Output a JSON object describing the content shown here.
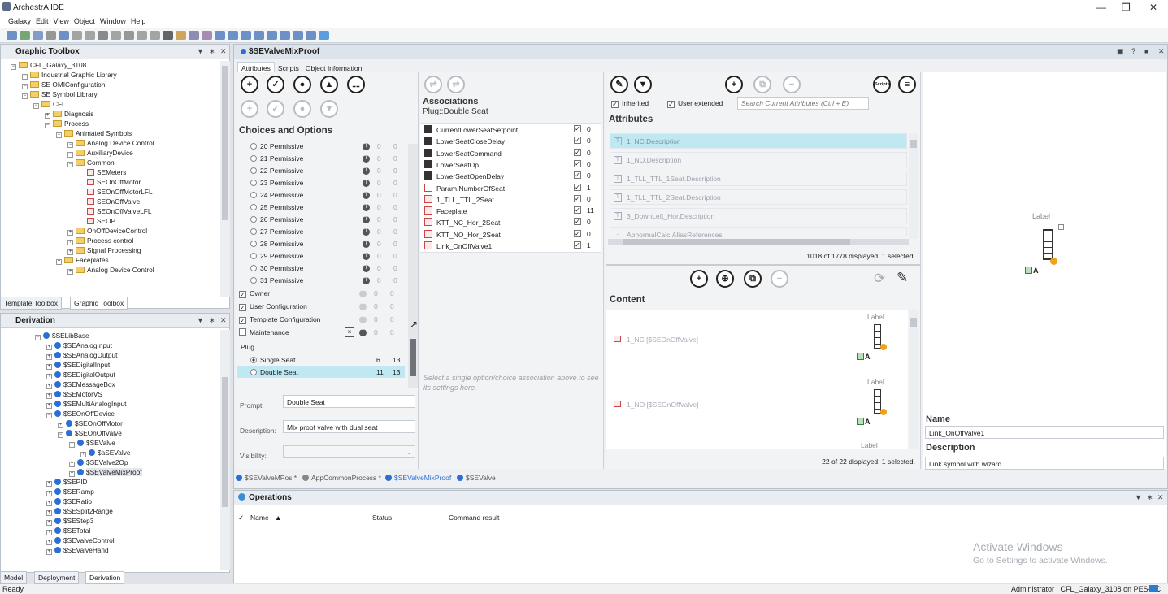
{
  "app": {
    "title": "ArchestrA IDE"
  },
  "menu": [
    "Galaxy",
    "Edit",
    "View",
    "Object",
    "Window",
    "Help"
  ],
  "toolbox": {
    "title": "Graphic Toolbox",
    "tree": [
      {
        "d": 0,
        "t": "CFL_Galaxy_3108",
        "k": "root"
      },
      {
        "d": 1,
        "t": "Industrial Graphic Library",
        "k": "folder"
      },
      {
        "d": 1,
        "t": "SE OMIConfiguration",
        "k": "folder"
      },
      {
        "d": 1,
        "t": "SE Symbol Library",
        "k": "folder"
      },
      {
        "d": 2,
        "t": "CFL",
        "k": "folder"
      },
      {
        "d": 3,
        "t": "Diagnosis",
        "k": "folder"
      },
      {
        "d": 3,
        "t": "Process",
        "k": "folder"
      },
      {
        "d": 4,
        "t": "Animated Symbols",
        "k": "folder"
      },
      {
        "d": 5,
        "t": "Analog Device Control",
        "k": "folder"
      },
      {
        "d": 5,
        "t": "AuxiliaryDevice",
        "k": "folder"
      },
      {
        "d": 5,
        "t": "Common",
        "k": "folder"
      },
      {
        "d": 6,
        "t": "SEMeters",
        "k": "sym"
      },
      {
        "d": 6,
        "t": "SEOnOffMotor",
        "k": "sym"
      },
      {
        "d": 6,
        "t": "SEOnOffMotorLFL",
        "k": "sym"
      },
      {
        "d": 6,
        "t": "SEOnOffValve",
        "k": "sym"
      },
      {
        "d": 6,
        "t": "SEOnOffValveLFL",
        "k": "sym"
      },
      {
        "d": 6,
        "t": "SEOP",
        "k": "sym"
      },
      {
        "d": 5,
        "t": "OnOffDeviceControl",
        "k": "folder"
      },
      {
        "d": 5,
        "t": "Process control",
        "k": "folder"
      },
      {
        "d": 5,
        "t": "Signal Processing",
        "k": "folder"
      },
      {
        "d": 4,
        "t": "Faceplates",
        "k": "folder"
      },
      {
        "d": 5,
        "t": "Analog Device Control",
        "k": "folder"
      }
    ],
    "tabs": [
      "Template Toolbox",
      "Graphic Toolbox"
    ]
  },
  "derivation": {
    "title": "Derivation",
    "tree": [
      {
        "d": 0,
        "t": "$SELibBase"
      },
      {
        "d": 1,
        "t": "$SEAnalogInput"
      },
      {
        "d": 1,
        "t": "$SEAnalogOutput"
      },
      {
        "d": 1,
        "t": "$SEDigitalInput"
      },
      {
        "d": 1,
        "t": "$SEDigitalOutput"
      },
      {
        "d": 1,
        "t": "$SEMessageBox"
      },
      {
        "d": 1,
        "t": "$SEMotorVS"
      },
      {
        "d": 1,
        "t": "$SEMultiAnalogInput"
      },
      {
        "d": 1,
        "t": "$SEOnOffDevice"
      },
      {
        "d": 2,
        "t": "$SEOnOffMotor"
      },
      {
        "d": 2,
        "t": "$SEOnOffValve"
      },
      {
        "d": 3,
        "t": "$SEValve"
      },
      {
        "d": 4,
        "t": "$aSEValve"
      },
      {
        "d": 3,
        "t": "$SEValve2Op"
      },
      {
        "d": 3,
        "t": "$SEValveMixProof"
      },
      {
        "d": 1,
        "t": "$SEPID"
      },
      {
        "d": 1,
        "t": "$SERamp"
      },
      {
        "d": 1,
        "t": "$SERatio"
      },
      {
        "d": 1,
        "t": "$SESplit2Range"
      },
      {
        "d": 1,
        "t": "$SEStep3"
      },
      {
        "d": 1,
        "t": "$SETotal"
      },
      {
        "d": 1,
        "t": "$SEValveControl"
      },
      {
        "d": 1,
        "t": "$SEValveHand"
      }
    ],
    "tabs": [
      "Model",
      "Deployment",
      "Derivation"
    ]
  },
  "editor": {
    "title": "$SEValveMixProof",
    "tabs": [
      "Attributes",
      "Scripts",
      "Object Information"
    ],
    "choices_title": "Choices and Options",
    "choices": [
      {
        "t": "20 Permissive",
        "a": "0",
        "b": "0",
        "type": "radio"
      },
      {
        "t": "21 Permissive",
        "a": "0",
        "b": "0",
        "type": "radio"
      },
      {
        "t": "22 Permissive",
        "a": "0",
        "b": "0",
        "type": "radio"
      },
      {
        "t": "23 Permissive",
        "a": "0",
        "b": "0",
        "type": "radio"
      },
      {
        "t": "24 Permissive",
        "a": "0",
        "b": "0",
        "type": "radio"
      },
      {
        "t": "25 Permissive",
        "a": "0",
        "b": "0",
        "type": "radio"
      },
      {
        "t": "26 Permissive",
        "a": "0",
        "b": "0",
        "type": "radio"
      },
      {
        "t": "27 Permissive",
        "a": "0",
        "b": "0",
        "type": "radio"
      },
      {
        "t": "28 Permissive",
        "a": "0",
        "b": "0",
        "type": "radio"
      },
      {
        "t": "29 Permissive",
        "a": "0",
        "b": "0",
        "type": "radio"
      },
      {
        "t": "30 Permissive",
        "a": "0",
        "b": "0",
        "type": "radio"
      },
      {
        "t": "31 Permissive",
        "a": "0",
        "b": "0",
        "type": "radio"
      },
      {
        "t": "Owner",
        "a": "0",
        "b": "0",
        "type": "check"
      },
      {
        "t": "User Configuration",
        "a": "0",
        "b": "0",
        "type": "check"
      },
      {
        "t": "Template Configuration",
        "a": "0",
        "b": "0",
        "type": "check"
      },
      {
        "t": "Maintenance",
        "a": "0",
        "b": "0",
        "type": "uncheck"
      }
    ],
    "plug_label": "Plug",
    "plug": [
      {
        "t": "Single Seat",
        "a": "6",
        "b": "13",
        "sel": true
      },
      {
        "t": "Double Seat",
        "a": "11",
        "b": "13",
        "sel": false
      }
    ],
    "prompt_label": "Prompt:",
    "prompt": "Double Seat",
    "desc_label": "Description:",
    "desc": "Mix proof valve with dual seat",
    "vis_label": "Visibility:",
    "assoc_title": "Associations",
    "assoc_sub": "Plug::Double Seat",
    "assoc": [
      {
        "t": "CurrentLowerSeatSetpoint",
        "v": "0",
        "k": "a"
      },
      {
        "t": "LowerSeatCloseDelay",
        "v": "0",
        "k": "a"
      },
      {
        "t": "LowerSeatCommand",
        "v": "0",
        "k": "a"
      },
      {
        "t": "LowerSeatOp",
        "v": "0",
        "k": "a"
      },
      {
        "t": "LowerSeatOpenDelay",
        "v": "0",
        "k": "a"
      },
      {
        "t": "Param.NumberOfSeat",
        "v": "1",
        "k": "p"
      },
      {
        "t": "1_TLL_TTL_2Seat",
        "v": "0",
        "k": "s"
      },
      {
        "t": "Faceplate",
        "v": "11",
        "k": "s"
      },
      {
        "t": "KTT_NC_Hor_2Seat",
        "v": "0",
        "k": "s"
      },
      {
        "t": "KTT_NO_Hor_2Seat",
        "v": "0",
        "k": "s"
      },
      {
        "t": "Link_OnOffValve1",
        "v": "1",
        "k": "s"
      }
    ],
    "assoc_hint": "Select a single option/choice association above to see its settings here.",
    "inherited": "Inherited",
    "user_ext": "User extended",
    "search_ph": "Search Current Attributes (Ctrl + E)",
    "attr_title": "Attributes",
    "attrs": [
      "1_NC.Description",
      "1_NO.Description",
      "1_TLL_TTL_1Seat.Description",
      "1_TLL_TTL_2Seat.Description",
      "3_DownLeft_Hor.Description",
      "AbnormalCalc.AliasReferences"
    ],
    "attr_status": "1018 of 1778 displayed. 1 selected.",
    "content_title": "Content",
    "content": [
      {
        "t": "1_NC [$SEOnOffValve]",
        "lbl": "Label"
      },
      {
        "t": "1_NO [$SEOnOffValve]",
        "lbl": "Label"
      }
    ],
    "content_more": "Label",
    "content_status": "22 of 22 displayed. 1 selected.",
    "preview_label": "Label",
    "name_title": "Name",
    "name": "Link_OnOffValve1",
    "descr_title": "Description",
    "descr": "Link symbol with wizard",
    "scripts_btn": "Scripts",
    "doc_tabs": [
      "$SEValveMPos *",
      "AppCommonProcess *",
      "$SEValveMixProof",
      "$SEValve"
    ]
  },
  "operations": {
    "title": "Operations",
    "cols": [
      "Name",
      "Status",
      "Command result"
    ]
  },
  "watermark": {
    "line1": "Activate Windows",
    "line2": "Go to Settings to activate Windows."
  },
  "status": {
    "left": "Ready",
    "right": "Administrator   CFL_Galaxy_3108 on PES-PC"
  }
}
